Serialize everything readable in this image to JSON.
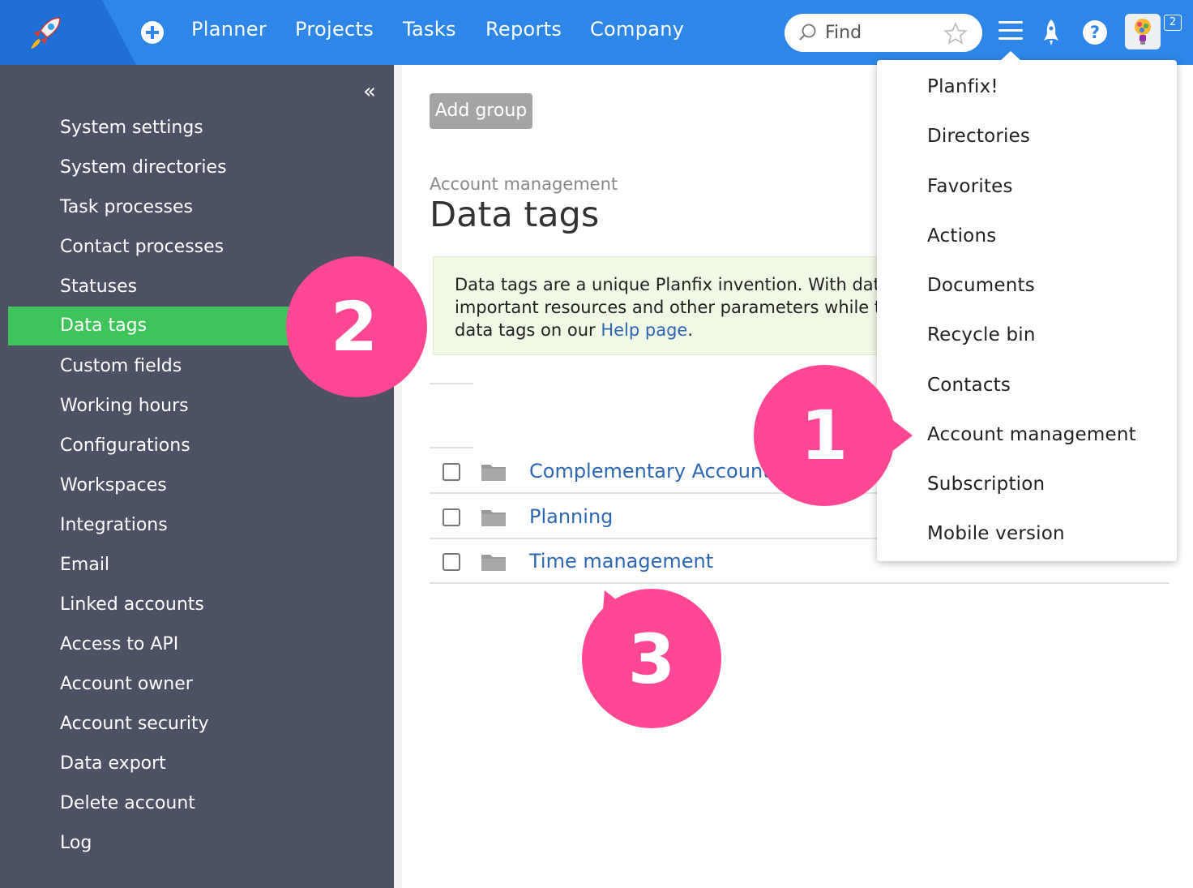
{
  "topbar": {
    "nav": [
      "Planner",
      "Projects",
      "Tasks",
      "Reports",
      "Company"
    ],
    "search_placeholder": "Find",
    "help_label": "?",
    "notification_count": "2"
  },
  "sidebar": {
    "collapse_label": "«",
    "items": [
      "System settings",
      "System directories",
      "Task processes",
      "Contact processes",
      "Statuses",
      "Data tags",
      "Custom fields",
      "Working hours",
      "Configurations",
      "Workspaces",
      "Integrations",
      "Email",
      "Linked accounts",
      "Access to API",
      "Account owner",
      "Account security",
      "Data export",
      "Delete account",
      "Log"
    ],
    "active_item": "Data tags"
  },
  "main": {
    "add_group_label": "Add group",
    "breadcrumb": "Account management",
    "title": "Data tags",
    "info": {
      "line1": "Data tags are a unique Planfix invention. With dat",
      "line2": "important resources and other parameters while t",
      "line3_prefix": "data tags on our ",
      "link": "Help page",
      "line3_suffix": "."
    },
    "rows": [
      "Complementary Accounting",
      "Planning",
      "Time management"
    ]
  },
  "dropdown": {
    "items": [
      "Planfix!",
      "Directories",
      "Favorites",
      "Actions",
      "Documents",
      "Recycle bin",
      "Contacts",
      "Account management",
      "Subscription",
      "Mobile version"
    ]
  },
  "callouts": [
    "1",
    "2",
    "3"
  ],
  "colors": {
    "topbar": "#2f86e9",
    "sidebar": "#4c5163",
    "active": "#3fc45b",
    "callout": "#ff4796",
    "link": "#2d67b4"
  }
}
